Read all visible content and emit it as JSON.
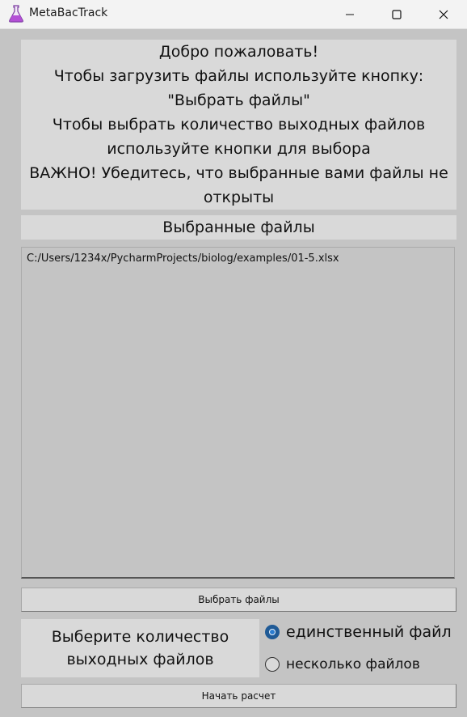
{
  "window": {
    "title": "MetaBacTrack",
    "icon": "flask-icon"
  },
  "info": {
    "lines": [
      "Добро пожаловать!",
      "Чтобы загрузить файлы используйте кнопку:",
      "\"Выбрать файлы\"",
      "Чтобы выбрать количество выходных файлов",
      "используйте кнопки для выбора",
      "ВАЖНО! Убедитесь, что выбранные вами файлы не",
      "открыты"
    ]
  },
  "files": {
    "header": "Выбранные файлы",
    "items": [
      "C:/Users/1234x/PycharmProjects/biolog/examples/01-5.xlsx"
    ]
  },
  "buttons": {
    "select_files": "Выбрать файлы",
    "start": "Начать расчет"
  },
  "output_count": {
    "label_lines": [
      "Выберите количество",
      "выходных файлов"
    ],
    "options": [
      {
        "label": "единственный файл",
        "selected": true
      },
      {
        "label": "несколько файлов",
        "selected": false
      }
    ]
  },
  "colors": {
    "background": "#c4c4c4",
    "panel": "#d9d9d9",
    "accent": "#1f5a96"
  }
}
